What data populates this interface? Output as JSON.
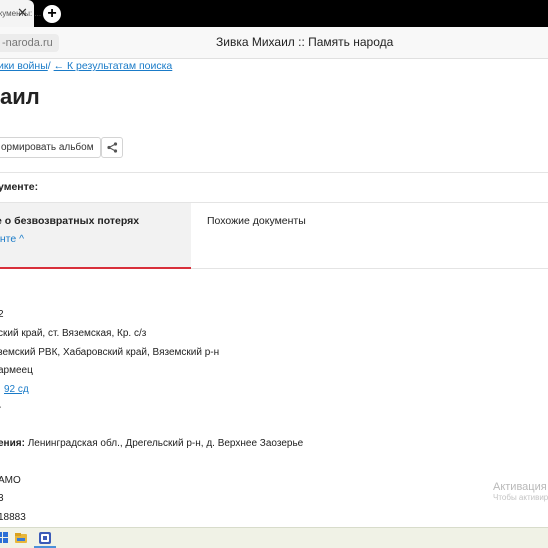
{
  "browser": {
    "tab_title": "дкументы: ...",
    "tab_close": "✕",
    "new_tab": "+",
    "url": "-naroda.ru",
    "window_title": "Зивка Михаил :: Память народа"
  },
  "breadcrumb": {
    "crumb": "ики войны",
    "separator": "/ ",
    "back_link": "← К результатам поиска"
  },
  "page": {
    "title": "аил",
    "album_button": "ормировать альбом",
    "documents_label": "ументе:"
  },
  "tabs": {
    "active_title": "е о безвозвратных потерях",
    "active_link": "енте ^",
    "similar": "Похожие документы"
  },
  "fields": {
    "f1": "2",
    "f2": "ский край, ст. Вяземская, Кр. с/з",
    "f3": "земский РВК, Хабаровский край, Вяземский р-н",
    "f4": "армеец",
    "f5_link": "92 сд",
    "f6": "-",
    "f7_label": "ения:",
    "f7_value": " Ленинградская обл., Дрегельский р-н, д. Верхнее Заозерье",
    "f8": "АМО",
    "f9": "3",
    "f10": "18883"
  },
  "watermark": {
    "line1": "Активация W",
    "line2": "Чтобы активир"
  },
  "taskbar": {
    "icons": [
      "windows-icon",
      "explorer-icon",
      "browser-icon"
    ]
  },
  "colors": {
    "link": "#1a7bc8",
    "accent_red": "#d8303a",
    "tabbar": "#000000"
  }
}
